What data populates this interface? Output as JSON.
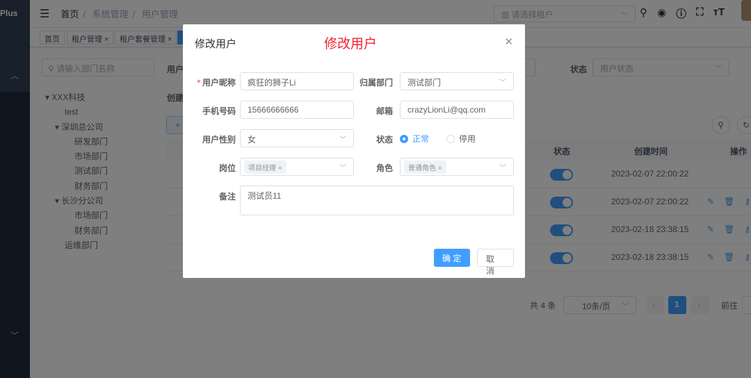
{
  "sidebar": {
    "logo": "Plus"
  },
  "navbar": {
    "breadcrumb": [
      "首页",
      "系统管理",
      "用户管理"
    ],
    "tenant_placeholder": "请选择租户"
  },
  "tags": [
    {
      "label": "首页"
    },
    {
      "label": "租户管理 ×"
    },
    {
      "label": "租户套餐管理 ×"
    }
  ],
  "dept_search_placeholder": "请输入部门名称",
  "tree": [
    "XXX科技",
    "test",
    "深圳总公司",
    "研发部门",
    "市场部门",
    "测试部门",
    "财务部门",
    "长沙分公司",
    "市场部门",
    "财务部门",
    "运维部门"
  ],
  "filters": {
    "user_label": "用户",
    "create_label": "创建",
    "status_label": "状态",
    "status_placeholder": "用户状态",
    "add_label": "+"
  },
  "table": {
    "headers": {
      "status": "状态",
      "created": "创建时间",
      "ops": "操作"
    },
    "rows": [
      {
        "created": "2023-02-07 22:00:22",
        "status_on": true
      },
      {
        "created": "2023-02-07 22:00:22",
        "status_on": true
      },
      {
        "created": "2023-02-18 23:38:15",
        "status_on": true
      },
      {
        "created": "2023-02-18 23:38:15",
        "status_on": true
      }
    ]
  },
  "pagination": {
    "total": "共 4 条",
    "page_size": "10条/页",
    "current": "1",
    "goto": "前往"
  },
  "dialog": {
    "title": "修改用户",
    "annotation": "修改用户",
    "fields": {
      "nickname_label": "用户昵称",
      "nickname": "疯狂的狮子Li",
      "dept_label": "归属部门",
      "dept": "测试部门",
      "phone_label": "手机号码",
      "phone": "15666666666",
      "email_label": "邮箱",
      "email": "crazyLionLi@qq.com",
      "gender_label": "用户性别",
      "gender": "女",
      "status_label": "状态",
      "status_options": [
        "正常",
        "停用"
      ],
      "post_label": "岗位",
      "post": "项目经理",
      "role_label": "角色",
      "role": "普通角色",
      "remark_label": "备注",
      "remark": "测试员11"
    },
    "confirm": "确 定",
    "cancel": "取 消"
  },
  "colors": {
    "primary": "#409eff",
    "annotation": "#f5222d",
    "sidebar": "#304156"
  }
}
